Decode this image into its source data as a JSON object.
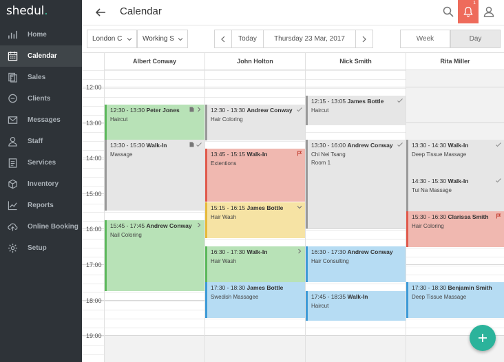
{
  "app": {
    "logo": "shedul",
    "logo_dot": "."
  },
  "sidebar": {
    "items": [
      {
        "label": "Home",
        "icon": "bar-chart-icon",
        "active": false
      },
      {
        "label": "Calendar",
        "icon": "calendar-icon",
        "active": true
      },
      {
        "label": "Sales",
        "icon": "receipt-icon",
        "active": false
      },
      {
        "label": "Clients",
        "icon": "chat-bubble-icon",
        "active": false
      },
      {
        "label": "Messages",
        "icon": "envelope-icon",
        "active": false
      },
      {
        "label": "Staff",
        "icon": "person-icon",
        "active": false
      },
      {
        "label": "Services",
        "icon": "clipboard-icon",
        "active": false
      },
      {
        "label": "Inventory",
        "icon": "box-icon",
        "active": false
      },
      {
        "label": "Reports",
        "icon": "line-chart-icon",
        "active": false
      },
      {
        "label": "Online Booking",
        "icon": "cloud-upload-icon",
        "active": false
      },
      {
        "label": "Setup",
        "icon": "gear-icon",
        "active": false
      }
    ]
  },
  "header": {
    "title": "Calendar",
    "notification_count": "1"
  },
  "toolbar": {
    "location": "London C",
    "staff_filter": "Working S",
    "today": "Today",
    "date": "Thursday 23 Mar, 2017",
    "views": [
      "Week",
      "Day"
    ],
    "active_view": "Day"
  },
  "calendar": {
    "staff": [
      "Albert Conway",
      "John Holton",
      "Nick Smith",
      "Rita Miller"
    ],
    "hours": [
      "12:00",
      "13:00",
      "14:00",
      "15:00",
      "16:00",
      "17:00",
      "18:00",
      "19:00"
    ],
    "appointments": [
      {
        "col": 0,
        "start": "12:30",
        "end": "13:30",
        "time": "12:30 - 13:30",
        "client": "Peter Jones",
        "service": "Haircut",
        "color": "green",
        "icons": [
          "note-icon",
          "chevron-right-icon"
        ]
      },
      {
        "col": 0,
        "start": "13:30",
        "end": "15:30",
        "time": "13:30 - 15:30",
        "client": "Walk-In",
        "service": "Massage",
        "color": "gray",
        "icons": [
          "note-icon",
          "check-icon"
        ]
      },
      {
        "col": 0,
        "start": "15:45",
        "end": "17:45",
        "time": "15:45 - 17:45",
        "client": "Andrew Conway",
        "service": "Nail Coloring",
        "color": "green",
        "icons": [
          "chevron-right-icon"
        ]
      },
      {
        "col": 1,
        "start": "12:30",
        "end": "13:30",
        "time": "12:30 - 13:30",
        "client": "Andrew Conway",
        "service": "Hair Coloring",
        "color": "gray",
        "icons": [
          "check-icon"
        ]
      },
      {
        "col": 1,
        "start": "13:45",
        "end": "15:15",
        "time": "13:45 - 15:15",
        "client": "Walk-In",
        "service": "Extentions",
        "color": "red",
        "icons": [
          "flag-icon"
        ]
      },
      {
        "col": 1,
        "start": "15:15",
        "end": "16:15",
        "time": "15:15 - 16:15",
        "client": "James Bottle",
        "service": "Hair Wash",
        "color": "yellow",
        "icons": [
          "chevron-down-icon"
        ]
      },
      {
        "col": 1,
        "start": "16:30",
        "end": "17:30",
        "time": "16:30 - 17:30",
        "client": "Walk-In",
        "service": "Hair Wash",
        "color": "green",
        "icons": [
          "chevron-right-icon"
        ]
      },
      {
        "col": 1,
        "start": "17:30",
        "end": "18:30",
        "time": "17:30 - 18:30",
        "client": "James Bottle",
        "service": "Swedish Massagee",
        "color": "blue",
        "icons": []
      },
      {
        "col": 2,
        "start": "12:15",
        "end": "13:05",
        "time": "12:15 - 13:05",
        "client": "James Bottle",
        "service": "Haircut",
        "color": "gray",
        "icons": [
          "check-icon"
        ]
      },
      {
        "col": 2,
        "start": "13:30",
        "end": "16:00",
        "time": "13:30 - 16:00",
        "client": "Andrew Conway",
        "service": "Chi Nei Tsang",
        "service2": "Room 1",
        "color": "gray",
        "icons": [
          "check-icon"
        ]
      },
      {
        "col": 2,
        "start": "16:30",
        "end": "17:30",
        "time": "16:30 - 17:30",
        "client": "Andrew Conway",
        "service": "Hair Consulting",
        "color": "blue",
        "icons": []
      },
      {
        "col": 2,
        "start": "17:45",
        "end": "18:35",
        "time": "17:45 - 18:35",
        "client": "Walk-In",
        "service": "Haircut",
        "color": "blue",
        "icons": []
      },
      {
        "col": 3,
        "start": "13:30",
        "end": "14:30",
        "time": "13:30 - 14:30",
        "client": "Walk-In",
        "service": "Deep Tissue Massage",
        "color": "gray",
        "icons": [
          "check-icon"
        ]
      },
      {
        "col": 3,
        "start": "14:30",
        "end": "15:30",
        "time": "14:30 - 15:30",
        "client": "Walk-In",
        "service": "Tui Na Massage",
        "color": "gray",
        "icons": [
          "check-icon"
        ]
      },
      {
        "col": 3,
        "start": "15:30",
        "end": "16:30",
        "time": "15:30 - 16:30",
        "client": "Clarissa Smith",
        "service": "Hair Coloring",
        "color": "red",
        "icons": [
          "flag-icon"
        ]
      },
      {
        "col": 3,
        "start": "17:30",
        "end": "18:30",
        "time": "17:30 - 18:30",
        "client": "Benjamin Smith",
        "service": "Deep Tissue Massage",
        "color": "blue",
        "icons": []
      }
    ]
  },
  "colors": {
    "sidebar_bg": "#2e3338",
    "accent": "#3cc09b",
    "notification": "#ee6b5b",
    "fab": "#2bb39b"
  }
}
